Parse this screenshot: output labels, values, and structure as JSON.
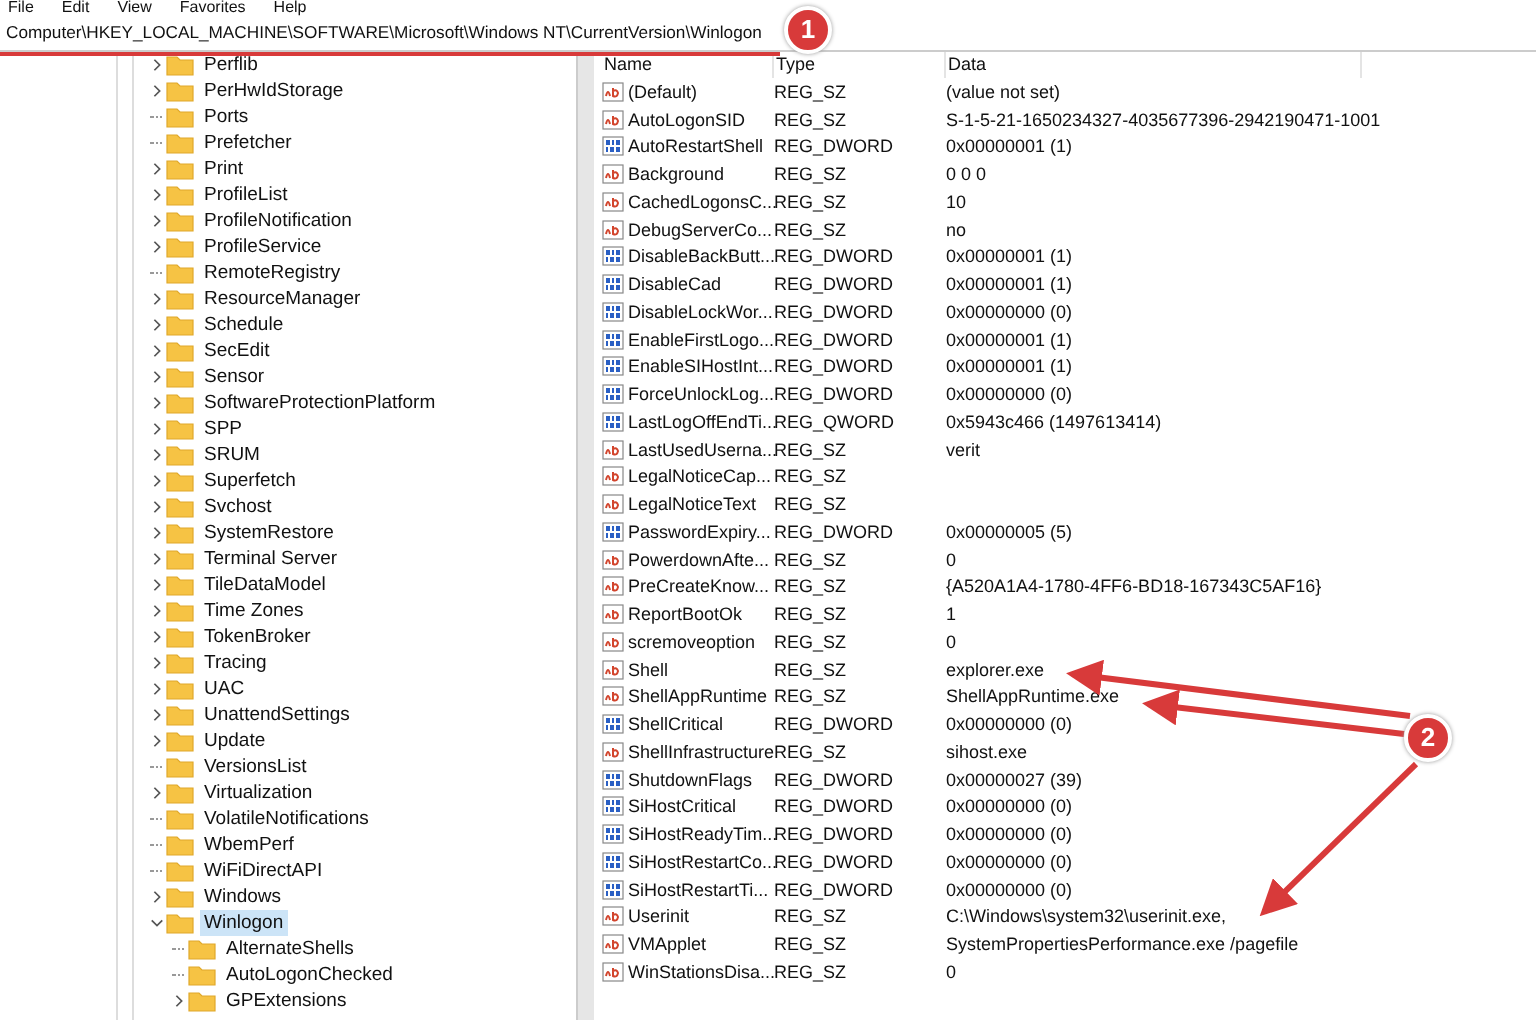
{
  "menu": [
    "File",
    "Edit",
    "View",
    "Favorites",
    "Help"
  ],
  "address": "Computer\\HKEY_LOCAL_MACHINE\\SOFTWARE\\Microsoft\\Windows NT\\CurrentVersion\\Winlogon",
  "tree": [
    {
      "label": "Perflib",
      "expandable": true,
      "expanded": false,
      "selected": false
    },
    {
      "label": "PerHwIdStorage",
      "expandable": true,
      "expanded": false,
      "selected": false
    },
    {
      "label": "Ports",
      "expandable": false,
      "selected": false
    },
    {
      "label": "Prefetcher",
      "expandable": false,
      "selected": false
    },
    {
      "label": "Print",
      "expandable": true,
      "expanded": false,
      "selected": false
    },
    {
      "label": "ProfileList",
      "expandable": true,
      "expanded": false,
      "selected": false
    },
    {
      "label": "ProfileNotification",
      "expandable": true,
      "expanded": false,
      "selected": false
    },
    {
      "label": "ProfileService",
      "expandable": true,
      "expanded": false,
      "selected": false
    },
    {
      "label": "RemoteRegistry",
      "expandable": false,
      "selected": false
    },
    {
      "label": "ResourceManager",
      "expandable": true,
      "expanded": false,
      "selected": false
    },
    {
      "label": "Schedule",
      "expandable": true,
      "expanded": false,
      "selected": false
    },
    {
      "label": "SecEdit",
      "expandable": true,
      "expanded": false,
      "selected": false
    },
    {
      "label": "Sensor",
      "expandable": true,
      "expanded": false,
      "selected": false
    },
    {
      "label": "SoftwareProtectionPlatform",
      "expandable": true,
      "expanded": false,
      "selected": false
    },
    {
      "label": "SPP",
      "expandable": true,
      "expanded": false,
      "selected": false
    },
    {
      "label": "SRUM",
      "expandable": true,
      "expanded": false,
      "selected": false
    },
    {
      "label": "Superfetch",
      "expandable": true,
      "expanded": false,
      "selected": false
    },
    {
      "label": "Svchost",
      "expandable": true,
      "expanded": false,
      "selected": false
    },
    {
      "label": "SystemRestore",
      "expandable": true,
      "expanded": false,
      "selected": false
    },
    {
      "label": "Terminal Server",
      "expandable": true,
      "expanded": false,
      "selected": false
    },
    {
      "label": "TileDataModel",
      "expandable": true,
      "expanded": false,
      "selected": false
    },
    {
      "label": "Time Zones",
      "expandable": true,
      "expanded": false,
      "selected": false
    },
    {
      "label": "TokenBroker",
      "expandable": true,
      "expanded": false,
      "selected": false
    },
    {
      "label": "Tracing",
      "expandable": true,
      "expanded": false,
      "selected": false
    },
    {
      "label": "UAC",
      "expandable": true,
      "expanded": false,
      "selected": false
    },
    {
      "label": "UnattendSettings",
      "expandable": true,
      "expanded": false,
      "selected": false
    },
    {
      "label": "Update",
      "expandable": true,
      "expanded": false,
      "selected": false
    },
    {
      "label": "VersionsList",
      "expandable": false,
      "selected": false
    },
    {
      "label": "Virtualization",
      "expandable": true,
      "expanded": false,
      "selected": false
    },
    {
      "label": "VolatileNotifications",
      "expandable": false,
      "selected": false
    },
    {
      "label": "WbemPerf",
      "expandable": false,
      "selected": false
    },
    {
      "label": "WiFiDirectAPI",
      "expandable": false,
      "selected": false
    },
    {
      "label": "Windows",
      "expandable": true,
      "expanded": false,
      "selected": false
    },
    {
      "label": "Winlogon",
      "expandable": true,
      "expanded": true,
      "selected": true,
      "children": [
        {
          "label": "AlternateShells",
          "expandable": false,
          "selected": false
        },
        {
          "label": "AutoLogonChecked",
          "expandable": false,
          "selected": false
        },
        {
          "label": "GPExtensions",
          "expandable": true,
          "expanded": false,
          "selected": false
        }
      ]
    }
  ],
  "table": {
    "columns": [
      "Name",
      "Type",
      "Data"
    ],
    "rows": [
      {
        "kind": "string",
        "name": "(Default)",
        "type": "REG_SZ",
        "data": "(value not set)"
      },
      {
        "kind": "string",
        "name": "AutoLogonSID",
        "type": "REG_SZ",
        "data": "S-1-5-21-1650234327-4035677396-2942190471-1001"
      },
      {
        "kind": "binary",
        "name": "AutoRestartShell",
        "type": "REG_DWORD",
        "data": "0x00000001 (1)"
      },
      {
        "kind": "string",
        "name": "Background",
        "type": "REG_SZ",
        "data": "0 0 0"
      },
      {
        "kind": "string",
        "name": "CachedLogonsC...",
        "type": "REG_SZ",
        "data": "10"
      },
      {
        "kind": "string",
        "name": "DebugServerCo...",
        "type": "REG_SZ",
        "data": "no"
      },
      {
        "kind": "binary",
        "name": "DisableBackButt...",
        "type": "REG_DWORD",
        "data": "0x00000001 (1)"
      },
      {
        "kind": "binary",
        "name": "DisableCad",
        "type": "REG_DWORD",
        "data": "0x00000001 (1)"
      },
      {
        "kind": "binary",
        "name": "DisableLockWor...",
        "type": "REG_DWORD",
        "data": "0x00000000 (0)"
      },
      {
        "kind": "binary",
        "name": "EnableFirstLogo...",
        "type": "REG_DWORD",
        "data": "0x00000001 (1)"
      },
      {
        "kind": "binary",
        "name": "EnableSIHostInt...",
        "type": "REG_DWORD",
        "data": "0x00000001 (1)"
      },
      {
        "kind": "binary",
        "name": "ForceUnlockLog...",
        "type": "REG_DWORD",
        "data": "0x00000000 (0)"
      },
      {
        "kind": "binary",
        "name": "LastLogOffEndTi...",
        "type": "REG_QWORD",
        "data": "0x5943c466 (1497613414)"
      },
      {
        "kind": "string",
        "name": "LastUsedUserna...",
        "type": "REG_SZ",
        "data": "verit"
      },
      {
        "kind": "string",
        "name": "LegalNoticeCap...",
        "type": "REG_SZ"
      },
      {
        "kind": "string",
        "name": "LegalNoticeText",
        "type": "REG_SZ"
      },
      {
        "kind": "binary",
        "name": "PasswordExpiry...",
        "type": "REG_DWORD",
        "data": "0x00000005 (5)"
      },
      {
        "kind": "string",
        "name": "PowerdownAfte...",
        "type": "REG_SZ",
        "data": "0"
      },
      {
        "kind": "string",
        "name": "PreCreateKnow...",
        "type": "REG_SZ",
        "data": "{A520A1A4-1780-4FF6-BD18-167343C5AF16}"
      },
      {
        "kind": "string",
        "name": "ReportBootOk",
        "type": "REG_SZ",
        "data": "1"
      },
      {
        "kind": "string",
        "name": "scremoveoption",
        "type": "REG_SZ",
        "data": "0"
      },
      {
        "kind": "string",
        "name": "Shell",
        "type": "REG_SZ",
        "data": "explorer.exe"
      },
      {
        "kind": "string",
        "name": "ShellAppRuntime",
        "type": "REG_SZ",
        "data": "ShellAppRuntime.exe"
      },
      {
        "kind": "binary",
        "name": "ShellCritical",
        "type": "REG_DWORD",
        "data": "0x00000000 (0)"
      },
      {
        "kind": "string",
        "name": "ShellInfrastructure",
        "type": "REG_SZ",
        "data": "sihost.exe"
      },
      {
        "kind": "binary",
        "name": "ShutdownFlags",
        "type": "REG_DWORD",
        "data": "0x00000027 (39)"
      },
      {
        "kind": "binary",
        "name": "SiHostCritical",
        "type": "REG_DWORD",
        "data": "0x00000000 (0)"
      },
      {
        "kind": "binary",
        "name": "SiHostReadyTim...",
        "type": "REG_DWORD",
        "data": "0x00000000 (0)"
      },
      {
        "kind": "binary",
        "name": "SiHostRestartCo...",
        "type": "REG_DWORD",
        "data": "0x00000000 (0)"
      },
      {
        "kind": "binary",
        "name": "SiHostRestartTi...",
        "type": "REG_DWORD",
        "data": "0x00000000 (0)"
      },
      {
        "kind": "string",
        "name": "Userinit",
        "type": "REG_SZ",
        "data": "C:\\Windows\\system32\\userinit.exe,"
      },
      {
        "kind": "string",
        "name": "VMApplet",
        "type": "REG_SZ",
        "data": "SystemPropertiesPerformance.exe /pagefile"
      },
      {
        "kind": "string",
        "name": "WinStationsDisa...",
        "type": "REG_SZ",
        "data": "0"
      }
    ]
  },
  "annotations": [
    {
      "label": "1"
    },
    {
      "label": "2"
    }
  ]
}
